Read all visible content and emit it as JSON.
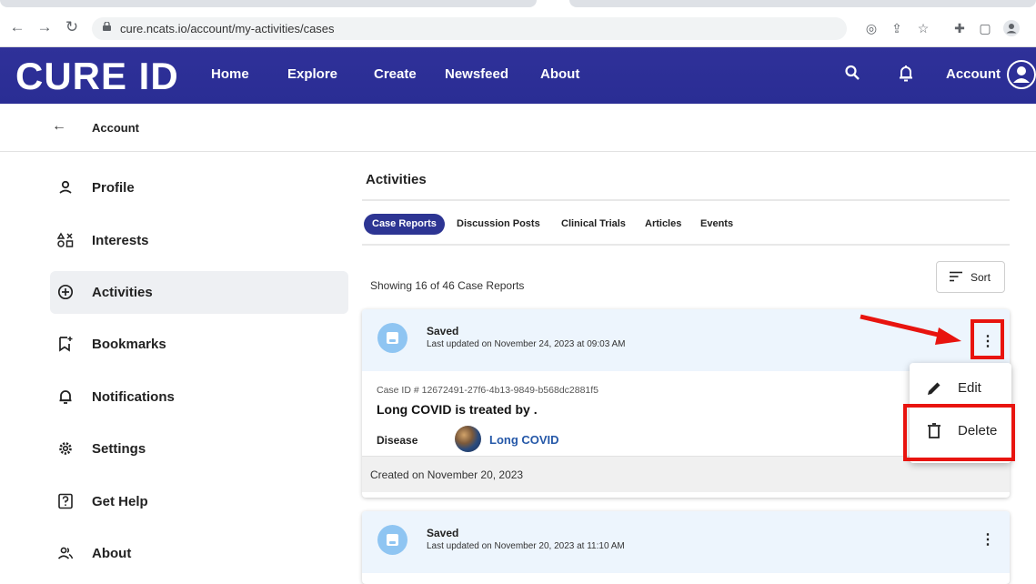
{
  "browser": {
    "url": "cure.ncats.io/account/my-activities/cases",
    "icons": [
      "back-arrow",
      "forward-arrow",
      "reload",
      "lock",
      "performance",
      "share",
      "star",
      "extensions",
      "sidepanel",
      "profile"
    ]
  },
  "topnav": {
    "logo": "CURE ID",
    "links": [
      "Home",
      "Explore",
      "Create",
      "Newsfeed",
      "About"
    ],
    "account_label": "Account"
  },
  "breadcrumb": {
    "label": "Account"
  },
  "sidebar": {
    "items": [
      {
        "label": "Profile",
        "icon": "person-icon",
        "active": false
      },
      {
        "label": "Interests",
        "icon": "interests-icon",
        "active": false
      },
      {
        "label": "Activities",
        "icon": "plus-circle-icon",
        "active": true
      },
      {
        "label": "Bookmarks",
        "icon": "bookmark-icon",
        "active": false
      },
      {
        "label": "Notifications",
        "icon": "bell-icon",
        "active": false
      },
      {
        "label": "Settings",
        "icon": "gear-icon",
        "active": false
      },
      {
        "label": "Get Help",
        "icon": "help-icon",
        "active": false
      },
      {
        "label": "About",
        "icon": "people-icon",
        "active": false
      }
    ]
  },
  "main": {
    "title": "Activities",
    "tabs": [
      "Case Reports",
      "Discussion Posts",
      "Clinical Trials",
      "Articles",
      "Events"
    ],
    "active_tab": "Case Reports",
    "showing": "Showing 16 of 46 Case Reports",
    "sort_label": "Sort"
  },
  "cards": [
    {
      "status": "Saved",
      "updated": "Last updated on November 24, 2023 at 09:03 AM",
      "case_id": "Case ID # 12672491-27f6-4b13-9849-b568dc2881f5",
      "title": "Long COVID is treated by .",
      "disease_label": "Disease",
      "disease": "Long COVID",
      "created": "Created on November 20, 2023"
    },
    {
      "status": "Saved",
      "updated": "Last updated on November 20, 2023 at 11:10 AM"
    }
  ],
  "menu": {
    "items": [
      "Edit",
      "Delete"
    ]
  },
  "colors": {
    "nav_bg": "#2e2e9a",
    "active_tab": "#2d3593",
    "link": "#2558a8",
    "annotation": "#e8140f",
    "card_head": "#edf5fd"
  }
}
